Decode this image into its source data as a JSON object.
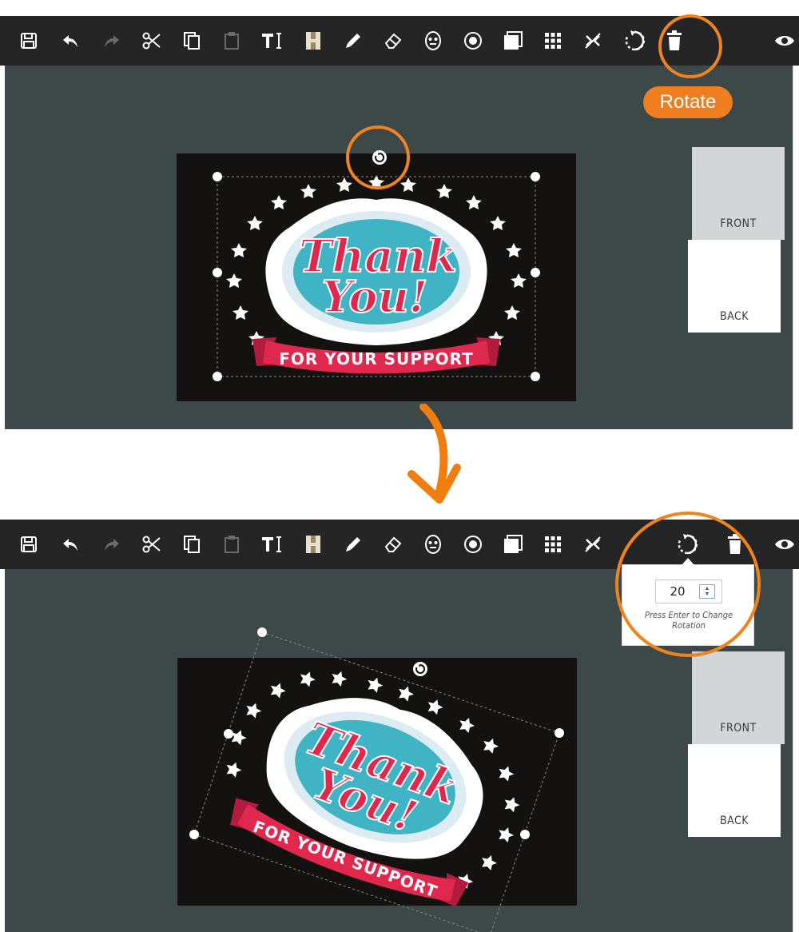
{
  "toolbar": {
    "tools": [
      "save-icon",
      "undo-icon",
      "redo-icon",
      "cut-icon",
      "copy-icon",
      "paste-icon",
      "add-text-icon",
      "add-image-icon",
      "draw-icon",
      "eraser-icon",
      "mask-icon",
      "sticker-icon",
      "layers-icon",
      "grid-icon",
      "no-bleed-icon",
      "rotate-icon",
      "delete-icon",
      "preview-icon"
    ]
  },
  "design": {
    "headline_line1": "Thank",
    "headline_line2": "You!",
    "banner_text": "FOR YOUR SUPPORT",
    "colors": {
      "card_background": "#131210",
      "oval": "#40b4c5",
      "headline": "#e0284f",
      "banner": "#e0284f",
      "stars": "#ffffff"
    }
  },
  "pages": {
    "front_label": "FRONT",
    "back_label": "BACK"
  },
  "tooltip": {
    "rotate_label": "Rotate"
  },
  "rotation_popup": {
    "value": "20",
    "hint": "Press Enter to Change Rotation"
  },
  "colors": {
    "toolbar": "#262525",
    "canvas": "#3d4849",
    "accent": "#ee7e1f"
  }
}
